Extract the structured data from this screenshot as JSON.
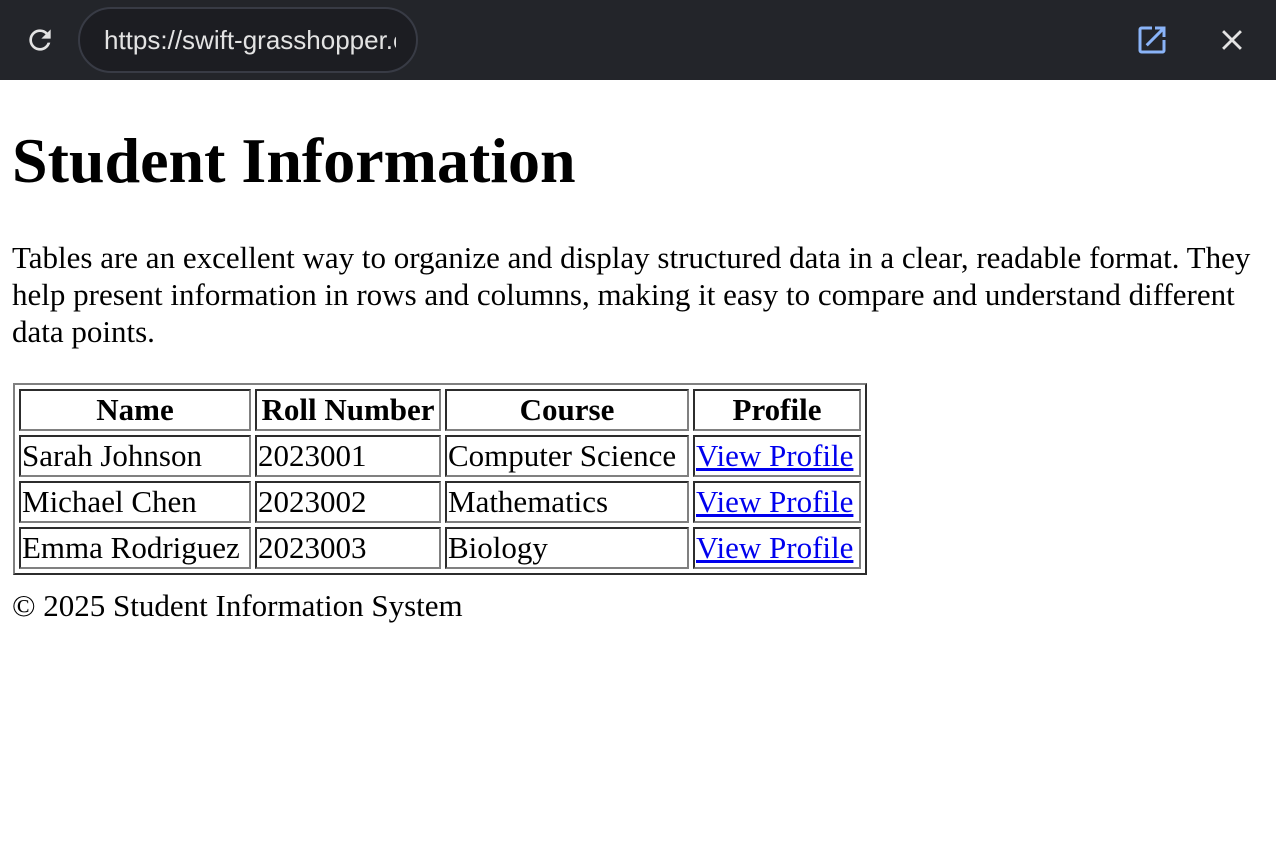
{
  "browser": {
    "url": "https://swift-grasshopper.example.com",
    "icons": {
      "reload": "reload-icon",
      "open_external": "open-external-icon",
      "close": "close-icon"
    },
    "colors": {
      "bar": "#23252a",
      "url_pill": "#1c1d22",
      "url_text": "#e3e3e3",
      "external_icon": "#8ab4f8",
      "close_icon": "#e3e3e3"
    }
  },
  "page": {
    "title": "Student Information",
    "intro": "Tables are an excellent way to organize and display structured data in a clear, readable format. They help present information in rows and columns, making it easy to compare and understand different data points.",
    "table": {
      "headers": [
        "Name",
        "Roll Number",
        "Course",
        "Profile"
      ],
      "rows": [
        {
          "name": "Sarah Johnson",
          "roll": "2023001",
          "course": "Computer Science",
          "profile": "View Profile"
        },
        {
          "name": "Michael Chen",
          "roll": "2023002",
          "course": "Mathematics",
          "profile": "View Profile"
        },
        {
          "name": "Emma Rodriguez",
          "roll": "2023003",
          "course": "Biology",
          "profile": "View Profile"
        }
      ]
    },
    "footer": "© 2025 Student Information System",
    "colors": {
      "link": "#0000ee",
      "text": "#000000"
    }
  }
}
